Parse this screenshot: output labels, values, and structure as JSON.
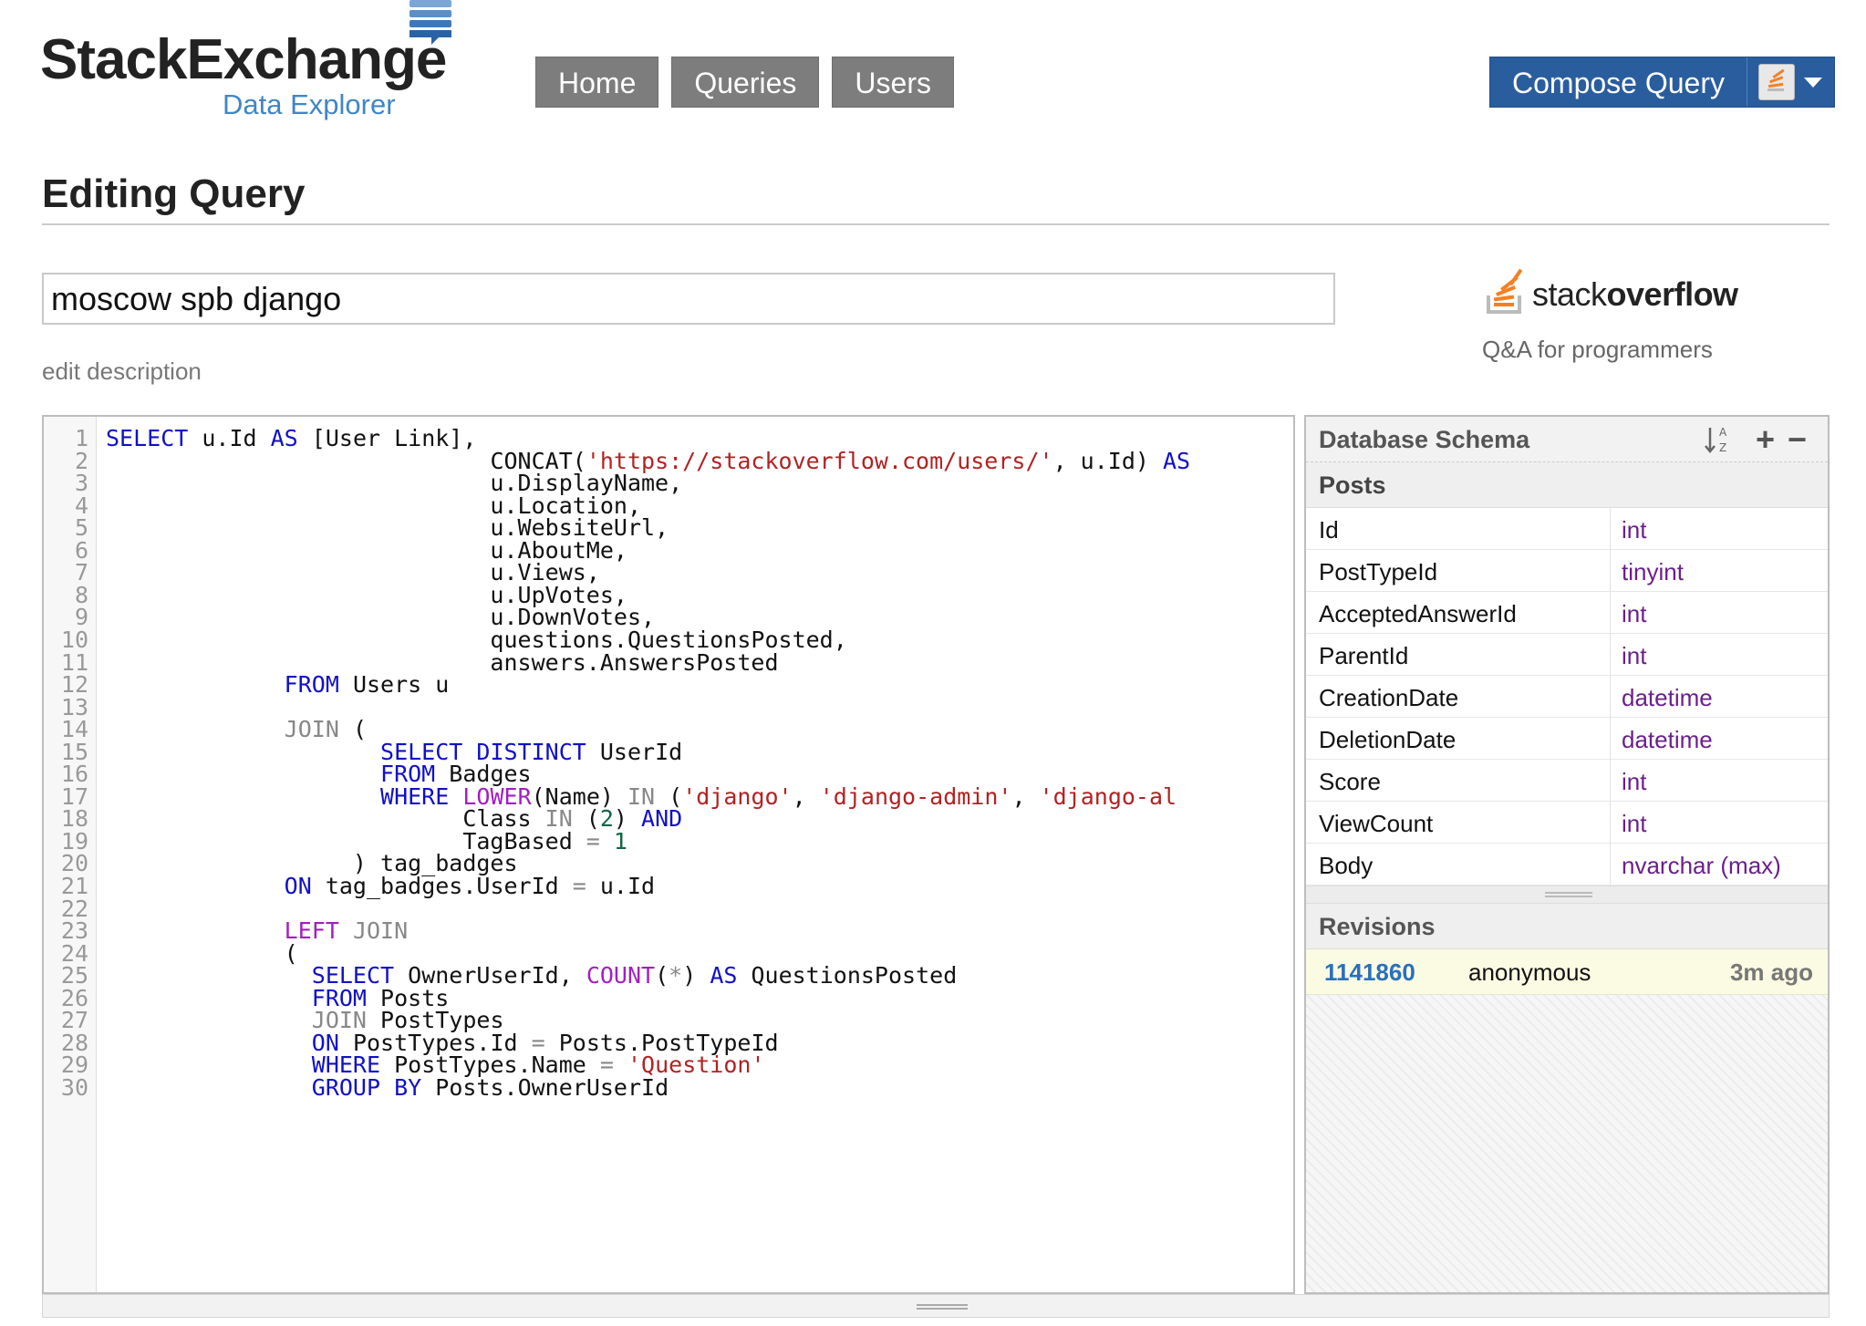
{
  "header": {
    "logo_brand": "StackExchange",
    "logo_sub": "Data Explorer",
    "nav": [
      "Home",
      "Queries",
      "Users"
    ],
    "compose_label": "Compose Query"
  },
  "page": {
    "title": "Editing Query",
    "query_name": "moscow spb django",
    "edit_description": "edit description",
    "site_name_light": "stack",
    "site_name_bold": "overflow",
    "site_tagline": "Q&A for programmers"
  },
  "editor": {
    "line_numbers": [
      "1",
      "2",
      "3",
      "4",
      "5",
      "6",
      "7",
      "8",
      "9",
      "10",
      "11",
      "12",
      "13",
      "14",
      "15",
      "16",
      "17",
      "18",
      "19",
      "20",
      "21",
      "22",
      "23",
      "24",
      "25",
      "26",
      "27",
      "28",
      "29",
      "30"
    ],
    "lines": [
      "SELECT u.Id AS [User Link],",
      "                            CONCAT('https://stackoverflow.com/users/', u.Id) AS",
      "                            u.DisplayName,",
      "                            u.Location,",
      "                            u.WebsiteUrl,",
      "                            u.AboutMe,",
      "                            u.Views,",
      "                            u.UpVotes,",
      "                            u.DownVotes,",
      "                            questions.QuestionsPosted,",
      "                            answers.AnswersPosted",
      "             FROM Users u",
      "",
      "             JOIN (",
      "                    SELECT DISTINCT UserId",
      "                    FROM Badges",
      "                    WHERE LOWER(Name) IN ('django', 'django-admin', 'django-al",
      "                          Class IN (2) AND",
      "                          TagBased = 1",
      "                  ) tag_badges",
      "             ON tag_badges.UserId = u.Id",
      "",
      "             LEFT JOIN",
      "             (",
      "               SELECT OwnerUserId, COUNT(*) AS QuestionsPosted",
      "               FROM Posts",
      "               JOIN PostTypes",
      "               ON PostTypes.Id = Posts.PostTypeId",
      "               WHERE PostTypes.Name = 'Question'",
      "               GROUP BY Posts.OwnerUserId"
    ]
  },
  "schema": {
    "title": "Database Schema",
    "table_name": "Posts",
    "columns": [
      {
        "name": "Id",
        "type": "int"
      },
      {
        "name": "PostTypeId",
        "type": "tinyint"
      },
      {
        "name": "AcceptedAnswerId",
        "type": "int"
      },
      {
        "name": "ParentId",
        "type": "int"
      },
      {
        "name": "CreationDate",
        "type": "datetime"
      },
      {
        "name": "DeletionDate",
        "type": "datetime"
      },
      {
        "name": "Score",
        "type": "int"
      },
      {
        "name": "ViewCount",
        "type": "int"
      },
      {
        "name": "Body",
        "type": "nvarchar (max)"
      }
    ],
    "revisions_title": "Revisions",
    "revision": {
      "id": "1141860",
      "user": "anonymous",
      "time": "3m ago"
    }
  },
  "colors": {
    "nav_bg": "#7d7d7d",
    "compose_bg": "#2a5d9e",
    "keyword": "#1010c8",
    "function": "#a31ec0",
    "string": "#b22222",
    "type": "#6b1f8c",
    "revision_link": "#2a6fbd"
  },
  "icons": [
    "stack-exchange-logo-icon",
    "stackoverflow-logo-icon",
    "site-icon",
    "chevron-down-icon",
    "sort-az-icon",
    "plus-icon",
    "minus-icon",
    "resize-grip-icon"
  ]
}
